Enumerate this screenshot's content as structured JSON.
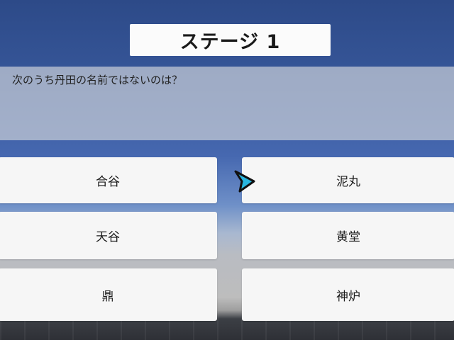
{
  "stage": {
    "title": "ステージ 1"
  },
  "question": {
    "text": "次のうち丹田の名前ではないのは？"
  },
  "answers": [
    {
      "label": "合谷"
    },
    {
      "label": "泥丸"
    },
    {
      "label": "天谷"
    },
    {
      "label": "黄堂"
    },
    {
      "label": "鼎"
    },
    {
      "label": "神炉"
    }
  ],
  "pointer": {
    "icon": "arrow-pointer-icon",
    "fill": "#29b6e0",
    "outline": "#111111"
  }
}
